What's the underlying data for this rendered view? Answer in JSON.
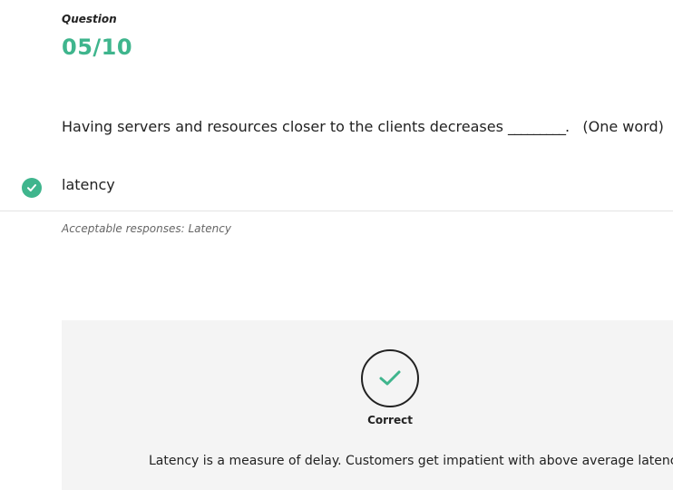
{
  "header": {
    "label": "Question",
    "number": "05/10"
  },
  "question": {
    "text_before": "Having servers and resources closer to the clients decreases",
    "blank": "_________.",
    "hint": "(One word)"
  },
  "answer": {
    "value": "latency",
    "status_icon": "check-circle-icon"
  },
  "acceptable": {
    "text": "Acceptable responses: Latency"
  },
  "feedback": {
    "status_icon": "check-icon",
    "label": "Correct",
    "explanation": "Latency is a measure of delay. Customers get impatient with above average latency."
  },
  "colors": {
    "accent": "#3fb58d",
    "panel": "#f4f4f4"
  }
}
